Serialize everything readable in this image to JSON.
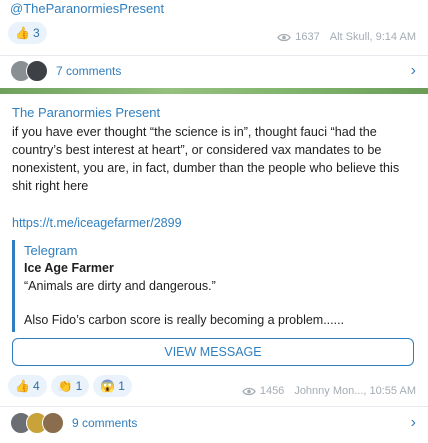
{
  "top": {
    "channel_handle": "@TheParanormiesPresent",
    "reactions": [
      {
        "emoji": "👍",
        "count": "3"
      }
    ],
    "views": "1637",
    "author_time": "Alt Skull, 9:14 AM",
    "comments_label": "7 comments"
  },
  "post": {
    "channel": "The Paranormies Present",
    "body": "if you have ever thought “the science is in”, thought fauci “had the country’s best interest at heart”, or considered vax mandates to be nonexistent, you are, in fact, dumber than the people who believe this shit right here",
    "link": "https://t.me/iceagefarmer/2899",
    "preview": {
      "site": "Telegram",
      "title": "Ice Age Farmer",
      "line1": "“Animals are dirty and dangerous.”",
      "line2": "Also Fido’s carbon score is really becoming a problem......"
    },
    "view_message_label": "VIEW MESSAGE",
    "reactions": [
      {
        "emoji": "👍",
        "count": "4"
      },
      {
        "emoji": "👏",
        "count": "1"
      },
      {
        "emoji": "😱",
        "count": "1"
      }
    ],
    "views": "1456",
    "author_time": "Johnny Mon..., 10:55 AM",
    "comments_label": "9 comments"
  },
  "colors": {
    "accent": "#2f7fc0",
    "green_strip": "#7fb36b",
    "reaction_bg": "#eaf3fb"
  }
}
